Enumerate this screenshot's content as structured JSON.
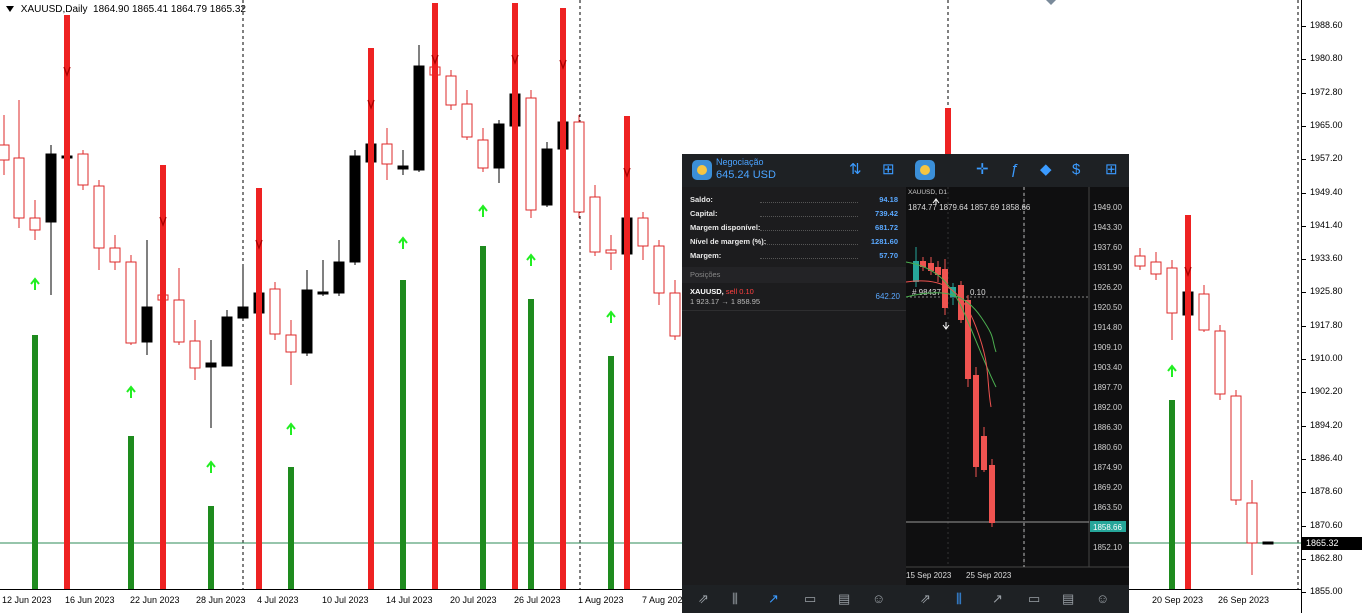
{
  "chart": {
    "symbol_label": "XAUUSD,Daily",
    "ohlc": "1864.90 1865.41 1864.79 1865.32",
    "current_price": "1865.32",
    "price_ticks": [
      "1988.60",
      "1980.80",
      "1972.80",
      "1965.00",
      "1957.20",
      "1949.40",
      "1941.40",
      "1933.60",
      "1925.80",
      "1917.80",
      "1910.00",
      "1902.20",
      "1894.20",
      "1886.40",
      "1878.60",
      "1870.60",
      "1862.80",
      "1855.00"
    ],
    "time_ticks": [
      "12 Jun 2023",
      "16 Jun 2023",
      "22 Jun 2023",
      "28 Jun 2023",
      "4 Jul 2023",
      "10 Jul 2023",
      "14 Jul 2023",
      "20 Jul 2023",
      "26 Jul 2023",
      "1 Aug 2023",
      "7 Aug 2023",
      "20 Sep 2023",
      "26 Sep 2023"
    ],
    "colors": {
      "bull": "#000000",
      "bear": "#dd2a2a",
      "signal_up": "#1e8b1e",
      "signal_down": "#ee2222",
      "arrow_up": "#22ee22"
    }
  },
  "mobile": {
    "header": {
      "title": "Negociação",
      "balance": "645.24 USD"
    },
    "header_icons": [
      "sort-icon",
      "new-order-icon",
      "app-logo-icon",
      "crosshair-icon",
      "indicators-icon",
      "objects-icon",
      "symbols-icon",
      "new-order-icon"
    ],
    "account": [
      {
        "label": "Saldo:",
        "value": "94.18"
      },
      {
        "label": "Capital:",
        "value": "739.42"
      },
      {
        "label": "Margem disponível:",
        "value": "681.72"
      },
      {
        "label": "Nível de margem (%):",
        "value": "1281.60"
      },
      {
        "label": "Margem:",
        "value": "57.70"
      }
    ],
    "positions_title": "Posições",
    "position": {
      "symbol": "XAUUSD,",
      "side": "sell 0.10",
      "prices": "1 923.17 → 1 858.95",
      "profit": "642.20"
    },
    "mini_chart": {
      "title": "XAUUSD, D1",
      "ohlc": "1874.77 1879.64 1857.69 1858.66",
      "order_line_label": "# 98437",
      "order_line_value": "0.10",
      "current_price": "1858.66",
      "price_ticks": [
        "1949.00",
        "1943.30",
        "1937.60",
        "1931.90",
        "1926.20",
        "1920.50",
        "1914.80",
        "1909.10",
        "1903.40",
        "1897.70",
        "1892.00",
        "1886.30",
        "1880.60",
        "1874.90",
        "1869.20",
        "1863.50",
        "1858.66",
        "1852.10"
      ],
      "time_ticks": [
        "15 Sep 2023",
        "25 Sep 2023"
      ]
    },
    "bottom_icons": [
      "quotes-icon",
      "chart-icon",
      "trade-icon",
      "history-icon",
      "news-icon",
      "chat-icon"
    ]
  }
}
